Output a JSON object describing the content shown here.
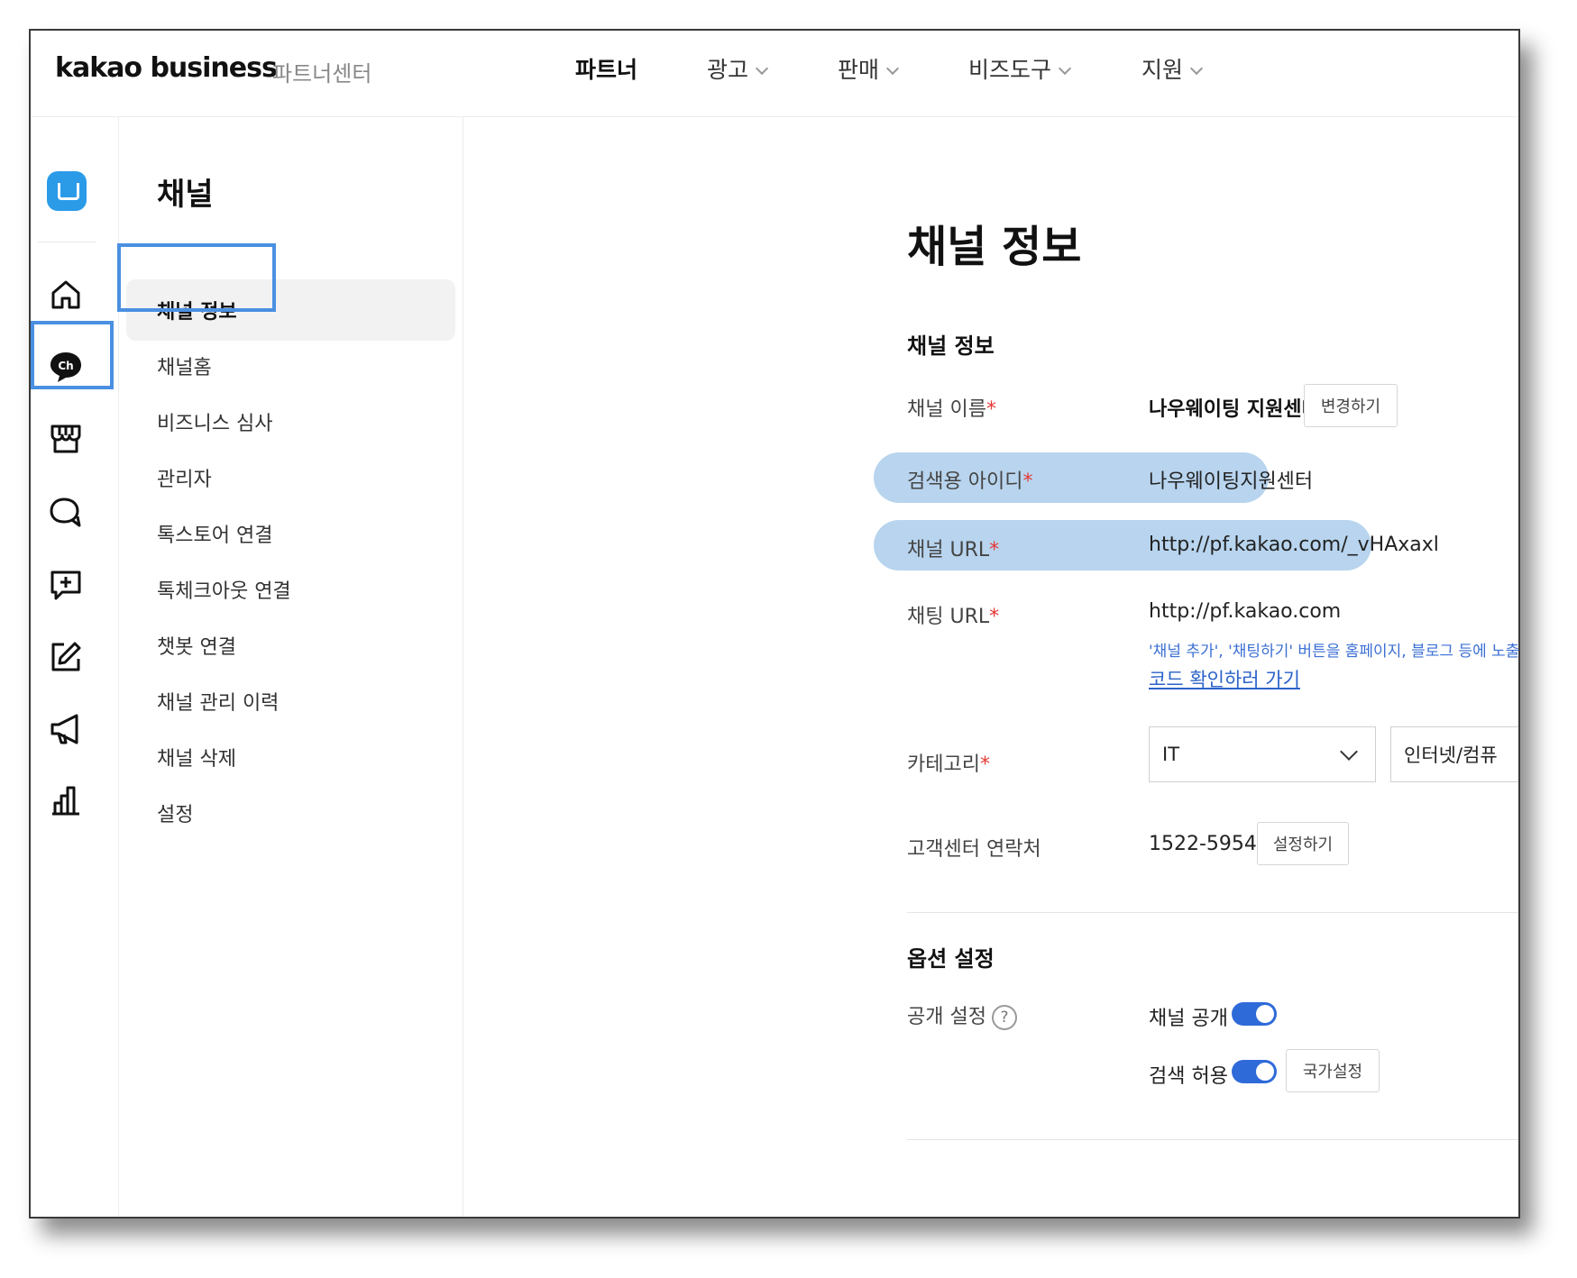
{
  "header": {
    "logo": "kakao business",
    "logo_sub": "파트너센터",
    "nav": [
      "파트너",
      "광고",
      "판매",
      "비즈도구",
      "지원"
    ]
  },
  "rail": {
    "icons": [
      "workspace-logo-icon",
      "home-icon",
      "channel-icon",
      "store-icon",
      "chat-icon",
      "message-add-icon",
      "edit-icon",
      "megaphone-icon",
      "stats-icon"
    ]
  },
  "submenu": {
    "title": "채널",
    "items": [
      "채널 정보",
      "채널홈",
      "비즈니스 심사",
      "관리자",
      "톡스토어 연결",
      "톡체크아웃 연결",
      "챗봇 연결",
      "채널 관리 이력",
      "채널 삭제",
      "설정"
    ]
  },
  "main": {
    "page_title": "채널 정보",
    "section1_title": "채널 정보",
    "channel_name_label": "채널 이름",
    "channel_name_value": "나우웨이팅 지원센터",
    "change_button": "변경하기",
    "search_id_label": "검색용 아이디",
    "search_id_value": "나우웨이팅지원센터",
    "channel_url_label": "채널 URL",
    "channel_url_value": "http://pf.kakao.com/_vHAxaxl",
    "chat_url_label": "채팅 URL",
    "chat_url_value": "http://pf.kakao.com",
    "chat_url_note": "'채널 추가', '채팅하기' 버튼을 홈페이지, 블로그 등에 노출",
    "code_link": "코드 확인하러 가기",
    "category_label": "카테고리",
    "category_value": "IT",
    "category_sub_value": "인터넷/컴퓨",
    "support_label": "고객센터 연락처",
    "support_value": "1522-5954",
    "set_button": "설정하기",
    "section2_title": "옵션 설정",
    "visibility_label": "공개 설정",
    "help_mark": "?",
    "public_label": "채널 공개",
    "search_allow_label": "검색 허용",
    "country_button": "국가설정",
    "required_mark": "*"
  },
  "colors": {
    "highlight_box": "#4a90e2",
    "highlight_pill": "#b8d4ee",
    "toggle_on": "#2f6ad9",
    "required": "#e53935"
  }
}
